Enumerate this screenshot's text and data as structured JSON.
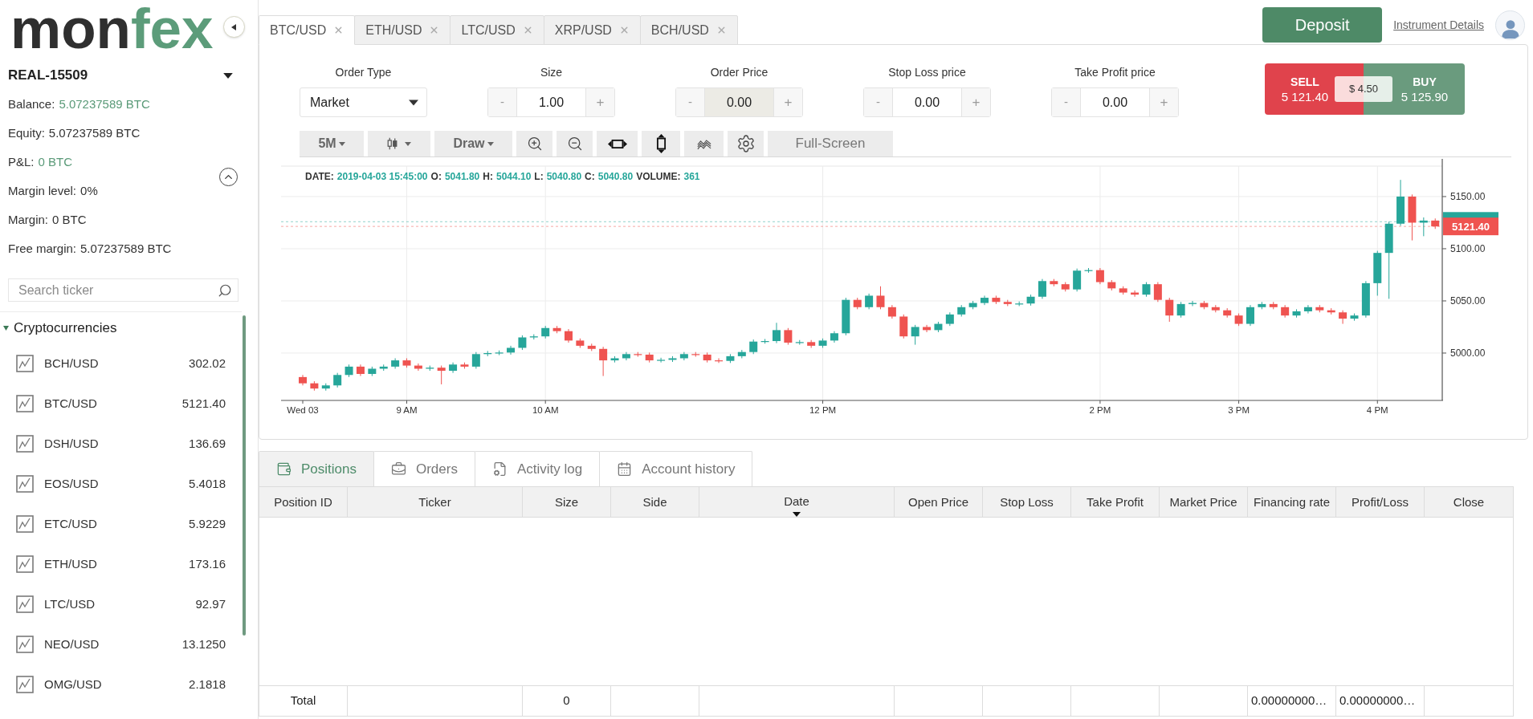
{
  "sidebar": {
    "logo": {
      "dark_part": "mon",
      "accent_part": "fex"
    },
    "account": {
      "name": "REAL-15509"
    },
    "summary": {
      "expanded": true,
      "rows": [
        {
          "label": "Balance:",
          "value": "5.07237589 BTC",
          "highlight": true
        },
        {
          "label": "Equity:",
          "value": "5.07237589 BTC",
          "highlight": false
        },
        {
          "label": "P&L:",
          "value": "0 BTC",
          "highlight": true
        },
        {
          "label": "Margin level:",
          "value": "0%",
          "highlight": false
        },
        {
          "label": "Margin:",
          "value": "0 BTC",
          "highlight": false
        },
        {
          "label": "Free margin:",
          "value": "5.07237589 BTC",
          "highlight": false
        }
      ]
    },
    "search": {
      "placeholder": "Search ticker"
    },
    "group": {
      "label": "Cryptocurrencies",
      "expanded": true,
      "items": [
        {
          "name": "BCH/USD",
          "price": "302.02"
        },
        {
          "name": "BTC/USD",
          "price": "5121.40"
        },
        {
          "name": "DSH/USD",
          "price": "136.69"
        },
        {
          "name": "EOS/USD",
          "price": "5.4018"
        },
        {
          "name": "ETC/USD",
          "price": "5.9229"
        },
        {
          "name": "ETH/USD",
          "price": "173.16"
        },
        {
          "name": "LTC/USD",
          "price": "92.97"
        },
        {
          "name": "NEO/USD",
          "price": "13.1250"
        },
        {
          "name": "OMG/USD",
          "price": "2.1818"
        }
      ]
    }
  },
  "instrument_tabs": [
    {
      "label": "BTC/USD",
      "selected": true
    },
    {
      "label": "ETH/USD",
      "selected": false
    },
    {
      "label": "LTC/USD",
      "selected": false
    },
    {
      "label": "XRP/USD",
      "selected": false
    },
    {
      "label": "BCH/USD",
      "selected": false
    }
  ],
  "header": {
    "deposit_button": "Deposit",
    "details_link": "Instrument Details"
  },
  "order_form": {
    "fields": [
      {
        "kind": "select",
        "label": "Order Type",
        "value": "Market"
      },
      {
        "kind": "stepper",
        "label": "Size",
        "value": "1.00",
        "disabled": false,
        "decrement": "-",
        "increment": "+"
      },
      {
        "kind": "stepper",
        "label": "Order Price",
        "value": "0.00",
        "disabled": true,
        "decrement": "-",
        "increment": "+"
      },
      {
        "kind": "stepper",
        "label": "Stop Loss price",
        "value": "0.00",
        "disabled": false,
        "decrement": "-",
        "increment": "+"
      },
      {
        "kind": "stepper",
        "label": "Take Profit price",
        "value": "0.00",
        "disabled": false,
        "decrement": "-",
        "increment": "+"
      }
    ]
  },
  "quote": {
    "sell": {
      "label": "SELL",
      "price": "5 121.40"
    },
    "spread": "$ 4.50",
    "buy": {
      "label": "BUY",
      "price": "5 125.90"
    }
  },
  "chart_toolbar": {
    "interval": "5M",
    "draw": "Draw",
    "fullscreen": "Full-Screen"
  },
  "chart": {
    "info": [
      {
        "label": "DATE:",
        "value": "2019-04-03 15:45:00"
      },
      {
        "label": "O:",
        "value": "5041.80"
      },
      {
        "label": "H:",
        "value": "5044.10"
      },
      {
        "label": "L:",
        "value": "5040.80"
      },
      {
        "label": "C:",
        "value": "5040.80"
      },
      {
        "label": "VOLUME:",
        "value": "361"
      }
    ],
    "chart_data": {
      "type": "candlestick",
      "categories": [
        "Wed 03",
        null,
        null,
        null,
        null,
        null,
        null,
        null,
        null,
        "9 AM",
        null,
        null,
        null,
        null,
        null,
        null,
        null,
        null,
        null,
        null,
        null,
        "10 AM",
        null,
        null,
        null,
        null,
        null,
        null,
        null,
        null,
        null,
        null,
        null,
        null,
        null,
        null,
        null,
        null,
        null,
        null,
        null,
        null,
        null,
        null,
        null,
        "12 PM",
        null,
        null,
        null,
        null,
        null,
        null,
        null,
        null,
        null,
        null,
        null,
        null,
        null,
        null,
        null,
        null,
        null,
        null,
        null,
        null,
        null,
        null,
        null,
        "2 PM",
        null,
        null,
        null,
        null,
        null,
        null,
        null,
        null,
        null,
        null,
        null,
        "3 PM",
        null,
        null,
        null,
        null,
        null,
        null,
        null,
        null,
        null,
        null,
        null,
        "4 PM",
        null,
        null,
        null,
        null,
        null
      ],
      "ohlc": [
        [
          4977,
          4979,
          4969,
          4971
        ],
        [
          4971,
          4973,
          4964,
          4966
        ],
        [
          4966,
          4971,
          4964,
          4969
        ],
        [
          4969,
          4981,
          4967,
          4979
        ],
        [
          4979,
          4989,
          4977,
          4987
        ],
        [
          4987,
          4989,
          4978,
          4980
        ],
        [
          4980,
          4987,
          4978,
          4985
        ],
        [
          4985,
          4989,
          4983,
          4987
        ],
        [
          4987,
          4995,
          4985,
          4993
        ],
        [
          4993,
          4995,
          4986,
          4988
        ],
        [
          4988,
          4990,
          4983,
          4985
        ],
        [
          4985,
          4988,
          4983,
          4986
        ],
        [
          4986,
          4988,
          4970,
          4983
        ],
        [
          4983,
          4991,
          4981,
          4989
        ],
        [
          4989,
          4991,
          4985,
          4987
        ],
        [
          4987,
          5001,
          4985,
          4999
        ],
        [
          4999,
          5002,
          4997,
          5000
        ],
        [
          5000,
          5002.5,
          4998,
          5000.5
        ],
        [
          5000.5,
          5007,
          4998.5,
          5005
        ],
        [
          5005,
          5017,
          5003,
          5015
        ],
        [
          5015,
          5018,
          5013,
          5016
        ],
        [
          5016,
          5026,
          5014,
          5024
        ],
        [
          5024,
          5026,
          5019,
          5021
        ],
        [
          5021,
          5023,
          5010,
          5012
        ],
        [
          5012,
          5014,
          5005,
          5007
        ],
        [
          5007,
          5009,
          5002,
          5004
        ],
        [
          5004,
          5006,
          4978,
          4993
        ],
        [
          4993,
          4997,
          4991,
          4995
        ],
        [
          4995,
          5001,
          4993,
          4999
        ],
        [
          4999,
          5001,
          4996.5,
          4998.5
        ],
        [
          4998.5,
          5000.5,
          4991,
          4993
        ],
        [
          4993,
          4995.5,
          4991,
          4993.5
        ],
        [
          4993.5,
          4997,
          4991.5,
          4995
        ],
        [
          4995,
          5001,
          4993,
          4999
        ],
        [
          4999,
          5001,
          4996.5,
          4998.5
        ],
        [
          4998.5,
          5000.5,
          4991,
          4993
        ],
        [
          4993,
          4995,
          4990.5,
          4992.5
        ],
        [
          4992.5,
          4999,
          4990.5,
          4997
        ],
        [
          4997,
          5003,
          4995,
          5001
        ],
        [
          5001,
          5013,
          4999,
          5011
        ],
        [
          5011,
          5013.5,
          5009,
          5011.5
        ],
        [
          5011.5,
          5029,
          5009.5,
          5022
        ],
        [
          5022,
          5024,
          5008,
          5010
        ],
        [
          5010,
          5012.5,
          5008,
          5010.5
        ],
        [
          5010.5,
          5012.5,
          5005,
          5007
        ],
        [
          5007,
          5014,
          5005,
          5012
        ],
        [
          5012,
          5021,
          5010,
          5019
        ],
        [
          5019,
          5053,
          5017,
          5051
        ],
        [
          5051,
          5053,
          5042,
          5044
        ],
        [
          5044,
          5057,
          5042,
          5055
        ],
        [
          5055,
          5064,
          5042,
          5044
        ],
        [
          5044,
          5046,
          5033,
          5035
        ],
        [
          5035,
          5037,
          5014,
          5016
        ],
        [
          5016,
          5027,
          5008,
          5025
        ],
        [
          5025,
          5027,
          5020,
          5022
        ],
        [
          5022,
          5030,
          5020,
          5028
        ],
        [
          5028,
          5039,
          5026,
          5037
        ],
        [
          5037,
          5046,
          5035,
          5044
        ],
        [
          5044,
          5050,
          5042,
          5048
        ],
        [
          5048,
          5055,
          5046,
          5053
        ],
        [
          5053,
          5055,
          5047,
          5049
        ],
        [
          5049,
          5051,
          5045,
          5047
        ],
        [
          5047,
          5049.5,
          5045,
          5047.5
        ],
        [
          5047.5,
          5056,
          5045.5,
          5054
        ],
        [
          5054,
          5071,
          5052,
          5069
        ],
        [
          5069,
          5071,
          5064,
          5066
        ],
        [
          5066,
          5068,
          5059,
          5061
        ],
        [
          5061,
          5081,
          5059,
          5079
        ],
        [
          5079,
          5081.5,
          5077,
          5079.5
        ],
        [
          5079.5,
          5081.5,
          5066,
          5068
        ],
        [
          5068,
          5070,
          5060,
          5062
        ],
        [
          5062,
          5064,
          5056,
          5058
        ],
        [
          5058,
          5060,
          5054,
          5056
        ],
        [
          5056,
          5068,
          5054,
          5066
        ],
        [
          5066,
          5068,
          5049,
          5051
        ],
        [
          5051,
          5053,
          5030,
          5036
        ],
        [
          5036,
          5049,
          5034,
          5047
        ],
        [
          5047,
          5050,
          5045,
          5048
        ],
        [
          5048,
          5050,
          5042,
          5044
        ],
        [
          5044,
          5046,
          5039,
          5041
        ],
        [
          5041,
          5043,
          5034,
          5036
        ],
        [
          5036,
          5038,
          5026,
          5028
        ],
        [
          5028,
          5046,
          5026,
          5044
        ],
        [
          5044,
          5049,
          5042,
          5047
        ],
        [
          5047,
          5049,
          5042,
          5044
        ],
        [
          5044,
          5046,
          5034,
          5036
        ],
        [
          5036,
          5042,
          5034,
          5040
        ],
        [
          5040,
          5046,
          5038,
          5044
        ],
        [
          5044,
          5046,
          5039,
          5041
        ],
        [
          5041,
          5043,
          5037,
          5039
        ],
        [
          5039,
          5041,
          5028,
          5033
        ],
        [
          5033,
          5038,
          5031,
          5036
        ],
        [
          5036,
          5069,
          5034,
          5067
        ],
        [
          5067,
          5098,
          5055,
          5096
        ],
        [
          5096,
          5126,
          5052,
          5124
        ],
        [
          5124,
          5166,
          5122,
          5150
        ],
        [
          5150,
          5152,
          5108,
          5125
        ],
        [
          5125,
          5130,
          5112,
          5127
        ],
        [
          5127,
          5129,
          5119,
          5121.4
        ]
      ],
      "ylim": [
        4954.6,
        5179.2
      ],
      "yticks": [
        {
          "value": 5000,
          "label": "5000.00"
        },
        {
          "value": 5050,
          "label": "5050.00"
        },
        {
          "value": 5100,
          "label": "5100.00"
        },
        {
          "value": 5150,
          "label": "5150.00"
        }
      ],
      "grid": true,
      "ref_lines": [
        {
          "axis": "y",
          "value": 5125.9,
          "color": "#26a69a"
        },
        {
          "axis": "y",
          "value": 5121.4,
          "color": "#ef5350",
          "label": "5121.40"
        }
      ]
    }
  },
  "bottom_tabs": [
    {
      "label": "Positions",
      "selected": true
    },
    {
      "label": "Orders",
      "selected": false
    },
    {
      "label": "Activity log",
      "selected": false
    },
    {
      "label": "Account history",
      "selected": false
    }
  ],
  "positions_table": {
    "columns": [
      {
        "label": "Position ID",
        "sorted": false,
        "total": "Total"
      },
      {
        "label": "Ticker",
        "sorted": false
      },
      {
        "label": "Size",
        "sorted": false,
        "total": "0"
      },
      {
        "label": "Side",
        "sorted": false
      },
      {
        "label": "Date",
        "sorted": true
      },
      {
        "label": "Open Price",
        "sorted": false
      },
      {
        "label": "Stop Loss",
        "sorted": false
      },
      {
        "label": "Take Profit",
        "sorted": false
      },
      {
        "label": "Market Price",
        "sorted": false
      },
      {
        "label": "Financing rate",
        "sorted": false,
        "total": "0.00000000…"
      },
      {
        "label": "Profit/Loss",
        "sorted": false,
        "total": "0.00000000…"
      },
      {
        "label": "Close",
        "sorted": false
      }
    ]
  }
}
